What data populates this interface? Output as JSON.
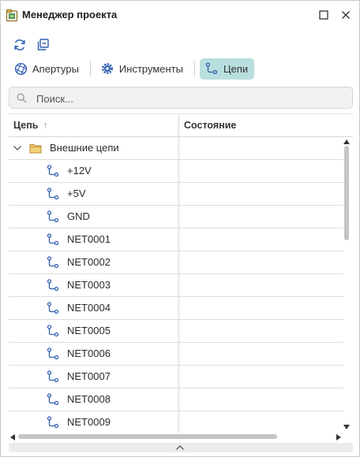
{
  "window": {
    "title": "Менеджер проекта"
  },
  "tabs": [
    {
      "label": "Апертуры",
      "icon": "aperture-icon",
      "active": false
    },
    {
      "label": "Инструменты",
      "icon": "tool-gear-icon",
      "active": false
    },
    {
      "label": "Цепи",
      "icon": "net-icon",
      "active": true
    }
  ],
  "search": {
    "placeholder": "Поиск..."
  },
  "table": {
    "columns": [
      {
        "label": "Цепь",
        "sort": "ascending"
      },
      {
        "label": "Состояние"
      }
    ],
    "group": {
      "label": "Внешние цепи",
      "expanded": true
    },
    "nets": [
      "+12V",
      "+5V",
      "GND",
      "NET0001",
      "NET0002",
      "NET0003",
      "NET0004",
      "NET0005",
      "NET0006",
      "NET0007",
      "NET0008",
      "NET0009"
    ]
  },
  "colors": {
    "active_tab_bg": "#b9dede",
    "icon_blue": "#2f5fb0",
    "folder_yellow": "#e8b84a"
  }
}
